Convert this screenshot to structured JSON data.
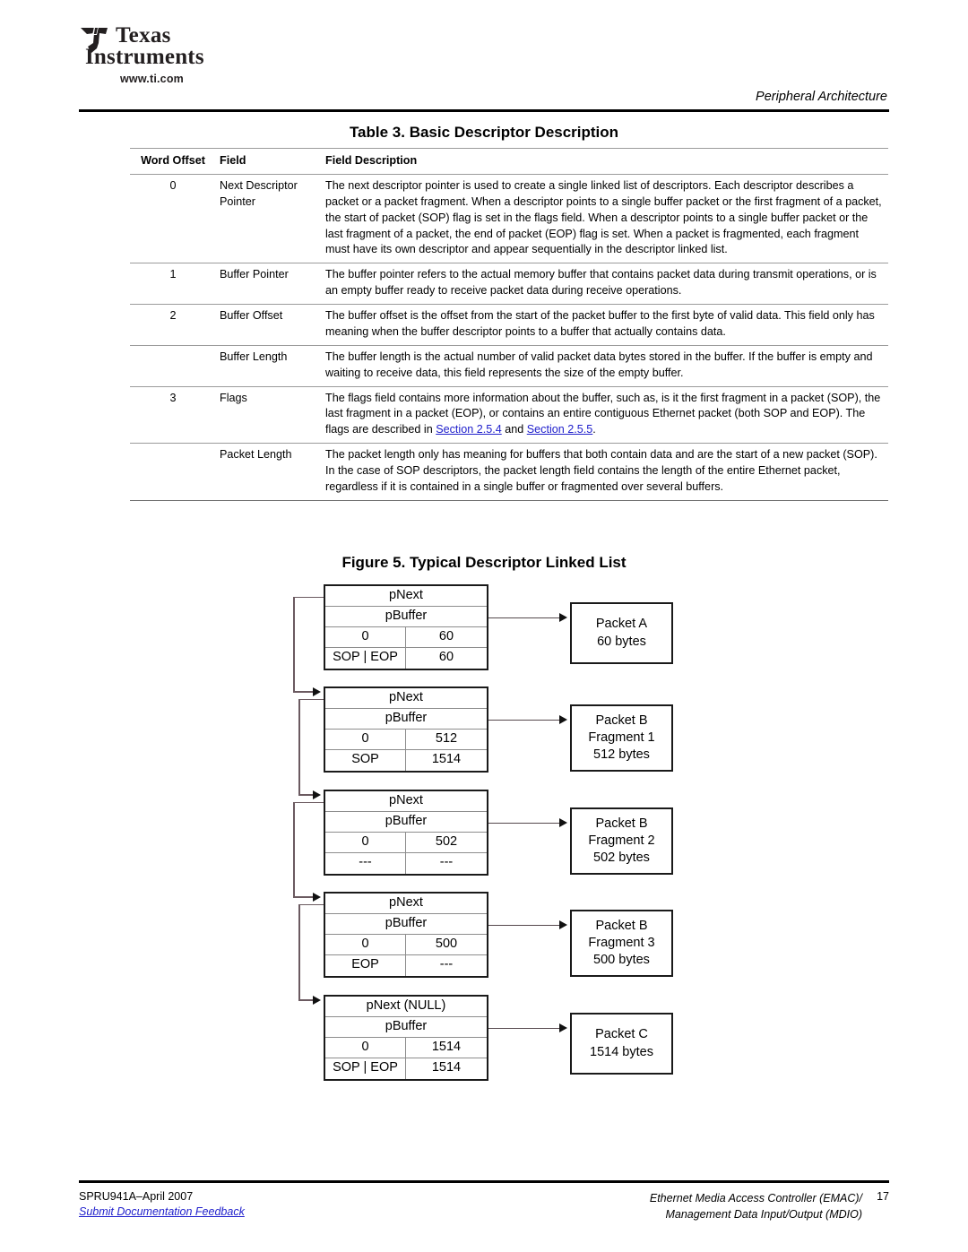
{
  "header": {
    "logo": {
      "line1": "Texas",
      "line2": "Instruments",
      "url": "www.ti.com"
    },
    "running_head": "Peripheral Architecture"
  },
  "table": {
    "title": "Table 3. Basic Descriptor Description",
    "columns": [
      "Word Offset",
      "Field",
      "Field Description"
    ],
    "rows": [
      {
        "offset": "0",
        "field": "Next Descriptor Pointer",
        "desc_before": "The next descriptor pointer is used to create a single linked list of descriptors. Each descriptor describes a packet or a packet fragment. When a descriptor points to a single buffer packet or the first fragment of a packet, the start of packet (SOP) flag is set in the flags field. When a descriptor points to a single buffer packet or the last fragment of a packet, the end of packet (EOP) flag is set. When a packet is fragmented, each fragment must have its own descriptor and appear sequentially in the descriptor linked list.",
        "new_group": true
      },
      {
        "offset": "1",
        "field": "Buffer Pointer",
        "desc_before": "The buffer pointer refers to the actual memory buffer that contains packet data during transmit operations, or is an empty buffer ready to receive packet data during receive operations.",
        "new_group": true
      },
      {
        "offset": "2",
        "field": "Buffer Offset",
        "desc_before": "The buffer offset is the offset from the start of the packet buffer to the first byte of valid data. This field only has meaning when the buffer descriptor points to a buffer that actually contains data.",
        "new_group": true
      },
      {
        "offset": "",
        "field": "Buffer Length",
        "desc_before": "The buffer length is the actual number of valid packet data bytes stored in the buffer. If the buffer is empty and waiting to receive data, this field represents the size of the empty buffer.",
        "new_group": true
      },
      {
        "offset": "3",
        "field": "Flags",
        "desc_before": "The flags field contains more information about the buffer, such as, is it the first fragment in a packet (SOP), the last fragment in a packet (EOP), or contains an entire contiguous Ethernet packet (both SOP and EOP). The flags are described in ",
        "link1": "Section 2.5.4",
        "desc_middle": " and ",
        "link2": "Section 2.5.5",
        "desc_after": ".",
        "new_group": true
      },
      {
        "offset": "",
        "field": "Packet Length",
        "desc_before": "The packet length only has meaning for buffers that both contain data and are the start of a new packet (SOP). In the case of SOP descriptors, the packet length field contains the length of the entire Ethernet packet, regardless if it is contained in a single buffer or fragmented over several buffers.",
        "new_group": true
      }
    ]
  },
  "figure": {
    "title": "Figure 5. Typical Descriptor Linked List",
    "descriptors": [
      {
        "pnext": "pNext",
        "pbuffer": "pBuffer",
        "offset": "0",
        "buffer_length": "60",
        "flags": "SOP | EOP",
        "packet_length": "60",
        "packet_lines": [
          "Packet A",
          "60 bytes"
        ]
      },
      {
        "pnext": "pNext",
        "pbuffer": "pBuffer",
        "offset": "0",
        "buffer_length": "512",
        "flags": "SOP",
        "packet_length": "1514",
        "packet_lines": [
          "Packet B",
          "Fragment 1",
          "512 bytes"
        ]
      },
      {
        "pnext": "pNext",
        "pbuffer": "pBuffer",
        "offset": "0",
        "buffer_length": "502",
        "flags": "---",
        "packet_length": "---",
        "packet_lines": [
          "Packet B",
          "Fragment 2",
          "502 bytes"
        ]
      },
      {
        "pnext": "pNext",
        "pbuffer": "pBuffer",
        "offset": "0",
        "buffer_length": "500",
        "flags": "EOP",
        "packet_length": "---",
        "packet_lines": [
          "Packet B",
          "Fragment 3",
          "500 bytes"
        ]
      },
      {
        "pnext": "pNext (NULL)",
        "pbuffer": "pBuffer",
        "offset": "0",
        "buffer_length": "1514",
        "flags": "SOP | EOP",
        "packet_length": "1514",
        "packet_lines": [
          "Packet C",
          "1514 bytes"
        ]
      }
    ]
  },
  "footer": {
    "doc_id": "SPRU941A–April 2007",
    "feedback": "Submit Documentation Feedback",
    "title_line1": "Ethernet Media Access Controller (EMAC)/",
    "title_line2": "Management Data Input/Output (MDIO)",
    "page": "17"
  },
  "colors": {
    "link": "#2020cc",
    "rule": "#9b9b9b",
    "box_border": "#1a1a1a"
  }
}
